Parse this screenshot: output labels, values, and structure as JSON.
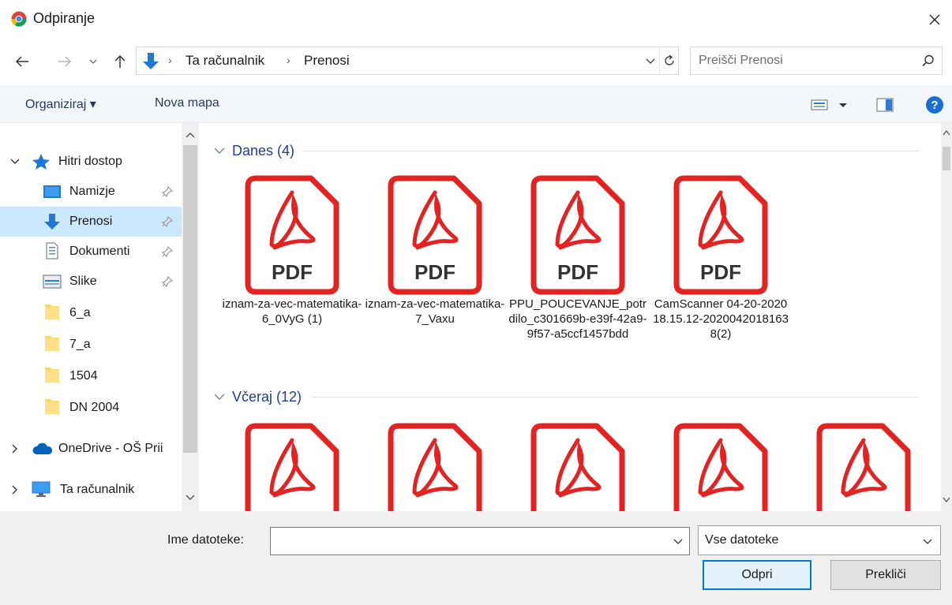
{
  "window": {
    "title": "Odpiranje"
  },
  "navigation": {
    "breadcrumb": [
      "Ta računalnik",
      "Prenosi"
    ],
    "search_placeholder": "Preišči Prenosi"
  },
  "toolbar": {
    "organize": "Organiziraj ▾",
    "new_folder": "Nova mapa"
  },
  "sidebar": {
    "quick_access": "Hitri dostop",
    "items": [
      {
        "label": "Namizje",
        "icon": "desktop-icon",
        "pinned": true
      },
      {
        "label": "Prenosi",
        "icon": "download-icon",
        "pinned": true,
        "selected": true
      },
      {
        "label": "Dokumenti",
        "icon": "document-icon",
        "pinned": true
      },
      {
        "label": "Slike",
        "icon": "pictures-icon",
        "pinned": true
      },
      {
        "label": "6_a",
        "icon": "folder-icon"
      },
      {
        "label": "7_a",
        "icon": "folder-icon"
      },
      {
        "label": "1504",
        "icon": "folder-icon"
      },
      {
        "label": "DN 2004",
        "icon": "folder-icon"
      }
    ],
    "onedrive": "OneDrive - OŠ Prii",
    "this_pc": "Ta računalnik"
  },
  "content": {
    "groups": [
      {
        "title": "Danes (4)",
        "files": [
          {
            "name": "iznam-za-vec-matematika-6_0VyG (1)",
            "type": "PDF"
          },
          {
            "name": "iznam-za-vec-matematika-7_Vaxu",
            "type": "PDF"
          },
          {
            "name": "PPU_POUCEVANJE_potrdilo_c301669b-e39f-42a9-9f57-a5ccf1457bdd",
            "type": "PDF"
          },
          {
            "name": "CamScanner 04-20-2020 18.15.12-20200420181638(2)",
            "type": "PDF"
          }
        ]
      },
      {
        "title": "Včeraj (12)",
        "files": [
          {
            "type": "PDF"
          },
          {
            "type": "PDF"
          },
          {
            "type": "PDF"
          },
          {
            "type": "PDF"
          },
          {
            "type": "PDF"
          }
        ]
      }
    ]
  },
  "footer": {
    "filename_label": "Ime datoteke:",
    "filename_value": "",
    "filetype_selected": "Vse datoteke",
    "open_button": "Odpri",
    "cancel_button": "Prekliči"
  },
  "colors": {
    "pdf_red": "#e52222",
    "accent": "#0078d7",
    "selection": "#cce8ff",
    "group_title": "#1e3f8c"
  }
}
